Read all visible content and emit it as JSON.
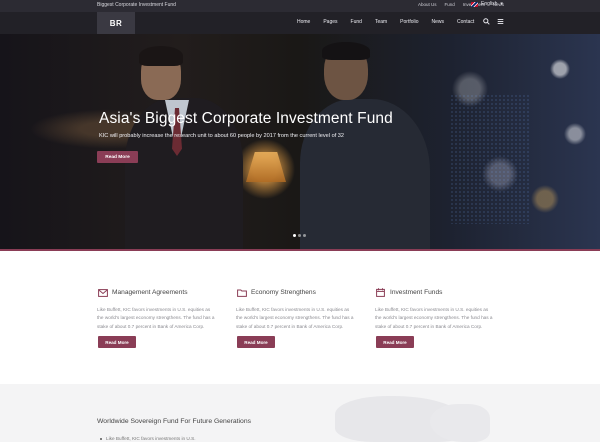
{
  "topbar": {
    "tagline": "Biggest Corporate Investment Fund",
    "links": [
      "About Us",
      "Fund",
      "Investment",
      "News"
    ],
    "language": "English"
  },
  "nav": {
    "logo": "BR",
    "items": [
      "Home",
      "Pages",
      "Fund",
      "Team",
      "Portfolio",
      "News",
      "Contact"
    ],
    "icons": [
      "search-icon",
      "menu-icon"
    ]
  },
  "hero": {
    "title": "Asia's Biggest Corporate Investment Fund",
    "subtitle": "KIC will probably increase the research unit to about 60 people by 2017 from the current level of 32",
    "button": "Read More",
    "slides_count": 3,
    "active_slide": 1
  },
  "features": [
    {
      "icon": "envelope-icon",
      "title": "Management Agreements",
      "lines": [
        "Like Buffett, KIC favors investments in U.S. equities as",
        "the world's largest economy strengthens. The fund has a",
        "stake of about 0.7 percent in Bank of America Corp."
      ],
      "button": "Read More"
    },
    {
      "icon": "folder-icon",
      "title": "Economy Strengthens",
      "lines": [
        "Like Buffett, KIC favors investments in U.S. equities as",
        "the world's largest economy strengthens. The fund has a",
        "stake of about 0.7 percent in Bank of America Corp."
      ],
      "button": "Read More"
    },
    {
      "icon": "calendar-icon",
      "title": "Investment Funds",
      "lines": [
        "Like Buffett, KIC favors investments in U.S. equities as",
        "the world's largest economy strengthens. The fund has a",
        "stake of about 0.7 percent in Bank of America Corp."
      ],
      "button": "Read More"
    }
  ],
  "bottom": {
    "title": "Worldwide Sovereign Fund For Future Generations",
    "item": "Like Buffett, KIC favors investments in U.S."
  },
  "colors": {
    "accent": "#8a3d56",
    "topbar": "#2c2b33",
    "nav": "#19181e"
  }
}
